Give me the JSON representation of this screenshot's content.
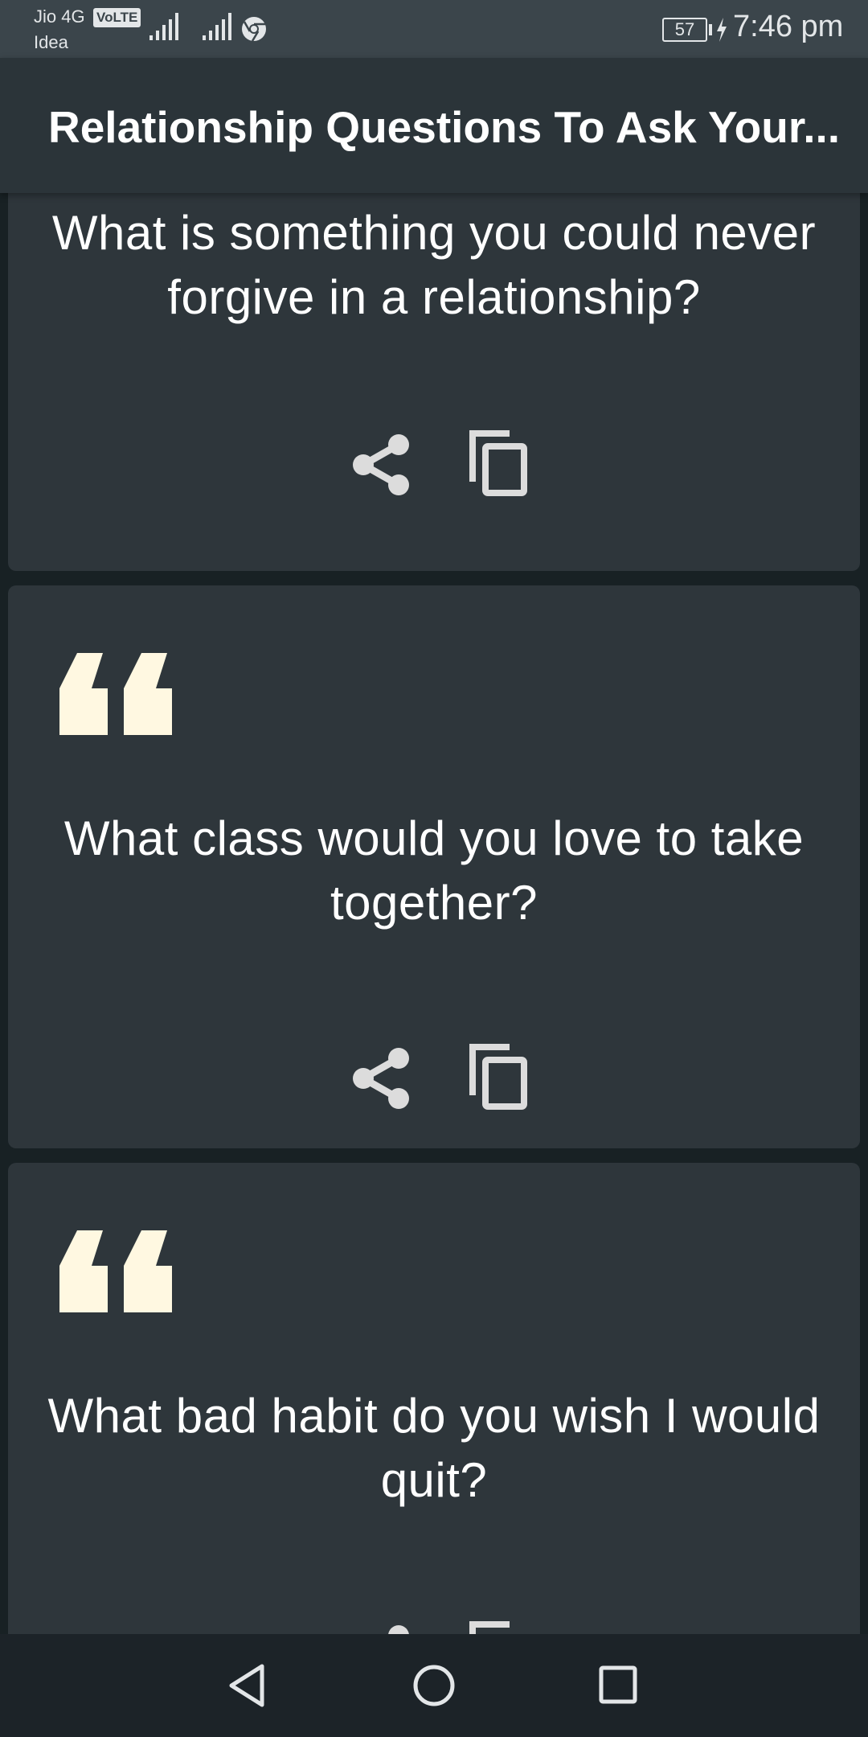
{
  "status_bar": {
    "carrier_1": "Jio 4G",
    "volte_badge": "VoLTE",
    "carrier_2": "Idea",
    "battery": "57",
    "time": "7:46 pm",
    "icons": [
      "signal-icon",
      "signal-icon",
      "chrome-icon",
      "charging-icon"
    ]
  },
  "app_bar": {
    "title": "Relationship Questions To Ask Your..."
  },
  "cards": [
    {
      "question": "What is something you could never forgive in a relationship?"
    },
    {
      "question": "What class would you love to take together?"
    },
    {
      "question": "What bad habit do you wish I would quit?"
    }
  ],
  "colors": {
    "background": "#182124",
    "card": "#2e363b",
    "app_bar": "#2b3439",
    "quote_mark": "#fff8e1",
    "action_icon": "#dcdcdc"
  },
  "nav_bar": {
    "icons": [
      "back-icon",
      "home-icon",
      "recents-icon"
    ]
  }
}
